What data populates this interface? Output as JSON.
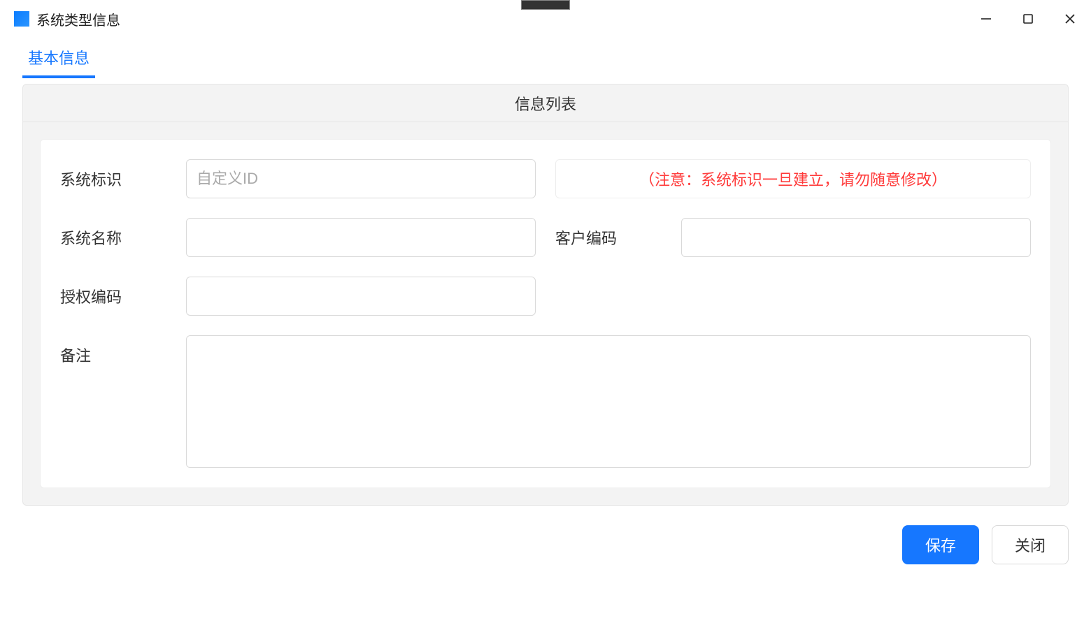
{
  "window": {
    "title": "系统类型信息"
  },
  "tabs": {
    "basic": "基本信息"
  },
  "panel": {
    "header": "信息列表"
  },
  "form": {
    "system_id": {
      "label": "系统标识",
      "placeholder": "自定义ID",
      "value": ""
    },
    "warning_note": "（注意：系统标识一旦建立，请勿随意修改）",
    "system_name": {
      "label": "系统名称",
      "value": ""
    },
    "customer_code": {
      "label": "客户编码",
      "value": ""
    },
    "auth_code": {
      "label": "授权编码",
      "value": ""
    },
    "remark": {
      "label": "备注",
      "value": ""
    }
  },
  "buttons": {
    "save": "保存",
    "close": "关闭"
  }
}
